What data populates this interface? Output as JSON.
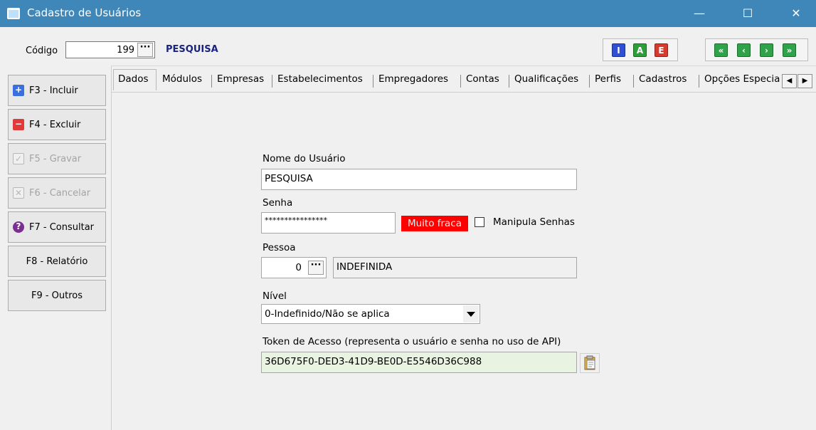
{
  "window": {
    "title": "Cadastro de Usuários",
    "minimize_glyph": "—",
    "maximize_glyph": "☐",
    "close_glyph": "✕"
  },
  "toolbar": {
    "codigo_label": "Código",
    "codigo_value": "199",
    "lookup_glyph": "···",
    "codigo_description": "PESQUISA",
    "mode_buttons": [
      {
        "letter": "I",
        "color": "#2f4fd6"
      },
      {
        "letter": "A",
        "color": "#2e9e3b"
      },
      {
        "letter": "E",
        "color": "#d83a2e"
      }
    ],
    "nav_buttons": [
      {
        "glyph": "«",
        "icon": "first-record-icon",
        "color": "#2ea34a"
      },
      {
        "glyph": "‹",
        "icon": "prev-record-icon",
        "color": "#2ea34a"
      },
      {
        "glyph": "›",
        "icon": "next-record-icon",
        "color": "#2ea34a"
      },
      {
        "glyph": "»",
        "icon": "last-record-icon",
        "color": "#2ea34a"
      }
    ]
  },
  "side_actions": [
    {
      "label": "F3 - Incluir",
      "icon": "plus-icon",
      "icon_glyph": "+",
      "icon_color": "#3a6fe0",
      "enabled": true
    },
    {
      "label": "F4 - Excluir",
      "icon": "minus-icon",
      "icon_glyph": "−",
      "icon_color": "#e03a3a",
      "enabled": true
    },
    {
      "label": "F5 - Gravar",
      "icon": "check-icon",
      "icon_glyph": "✓",
      "icon_color": "#c8c8c8",
      "enabled": false
    },
    {
      "label": "F6 - Cancelar",
      "icon": "x-box-icon",
      "icon_glyph": "✕",
      "icon_color": "#c8c8c8",
      "enabled": false
    },
    {
      "label": "F7 - Consultar",
      "icon": "question-icon",
      "icon_glyph": "?",
      "icon_color": "#7b2e8f",
      "enabled": true
    },
    {
      "label": "F8 - Relatório",
      "icon": "",
      "enabled": true
    },
    {
      "label": "F9 - Outros",
      "icon": "",
      "enabled": true
    }
  ],
  "tabs": [
    "Dados",
    "Módulos",
    "Empresas",
    "Estabelecimentos",
    "Empregadores",
    "Contas",
    "Qualificações",
    "Perfis",
    "Cadastros",
    "Opções Especia"
  ],
  "active_tab": "Dados",
  "tab_scroll": {
    "left": "◀",
    "right": "▶"
  },
  "form": {
    "nome_label": "Nome do Usuário",
    "nome_value": "PESQUISA",
    "senha_label": "Senha",
    "senha_value": "****************",
    "senha_strength": "Muito fraca",
    "senha_strength_color": "#ff0000",
    "manipula_label": "Manipula Senhas",
    "manipula_checked": false,
    "pessoa_label": "Pessoa",
    "pessoa_code": "0",
    "pessoa_name": "INDEFINIDA",
    "nivel_label": "Nível",
    "nivel_value": "0-Indefinido/Não se aplica",
    "token_label": "Token de Acesso (representa o usuário e senha no uso de API)",
    "token_value": "36D675F0-DED3-41D9-BE0D-E5546D36C988"
  },
  "accent_color": "#3e87b8"
}
